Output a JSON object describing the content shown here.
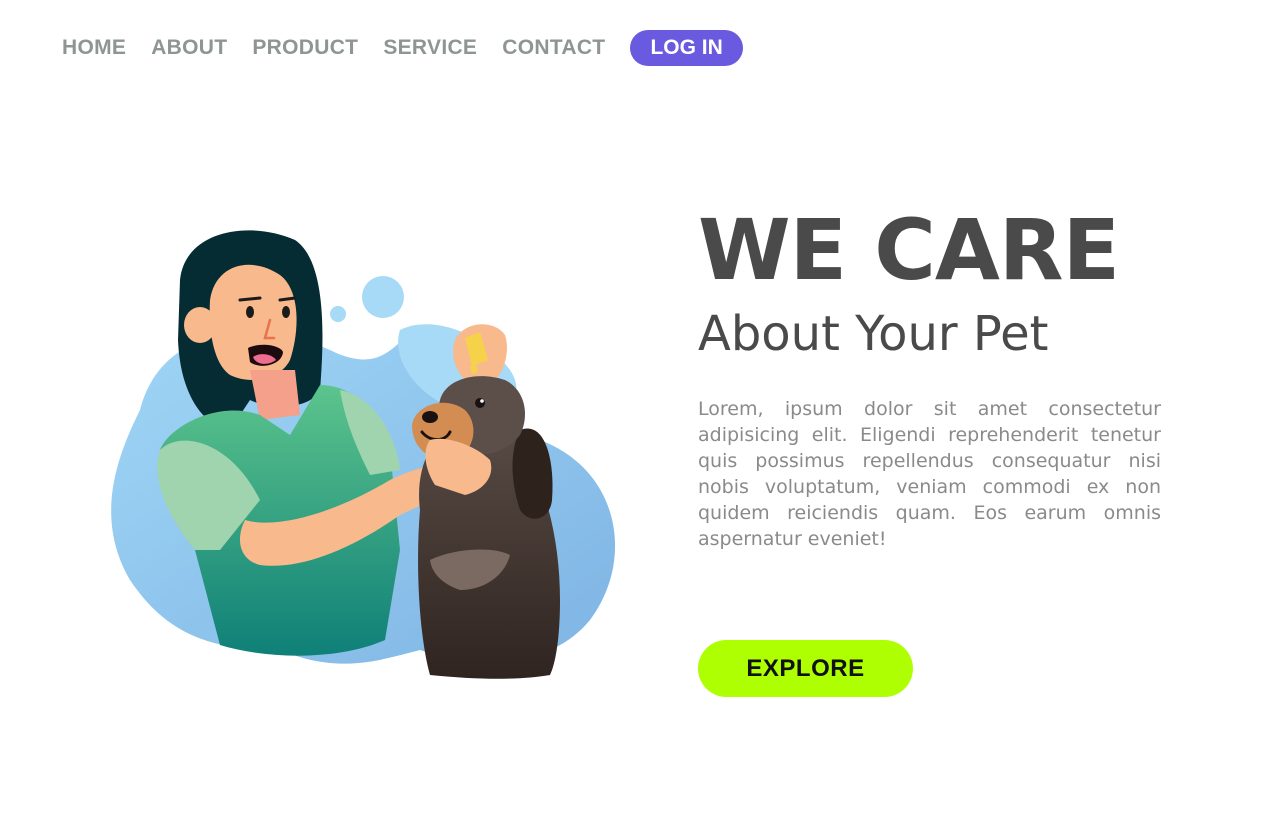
{
  "nav": {
    "links": [
      {
        "label": "HOME"
      },
      {
        "label": "ABOUT"
      },
      {
        "label": "PRODUCT"
      },
      {
        "label": "SERVICE"
      },
      {
        "label": "CONTACT"
      }
    ],
    "login_label": "LOG IN"
  },
  "hero": {
    "title": "WE CARE",
    "subtitle": "About Your Pet",
    "body": "Lorem, ipsum dolor sit amet consectetur adipisicing elit. Eligendi reprehenderit tenetur quis possimus repellendus consequatur nisi nobis voluptatum, veniam commodi ex non quidem reiciendis quam. Eos earum omnis aspernatur eveniet!",
    "cta_label": "EXPLORE"
  },
  "colors": {
    "nav_text": "#8e9593",
    "login_bg": "#6a5ae0",
    "heading": "#4a4a4a",
    "body_text": "#8a8a8a",
    "cta_bg": "#adff02",
    "blob": "#8ec7ef"
  },
  "illustration": {
    "icon": "woman-giving-dog-eye-drops-illustration"
  }
}
